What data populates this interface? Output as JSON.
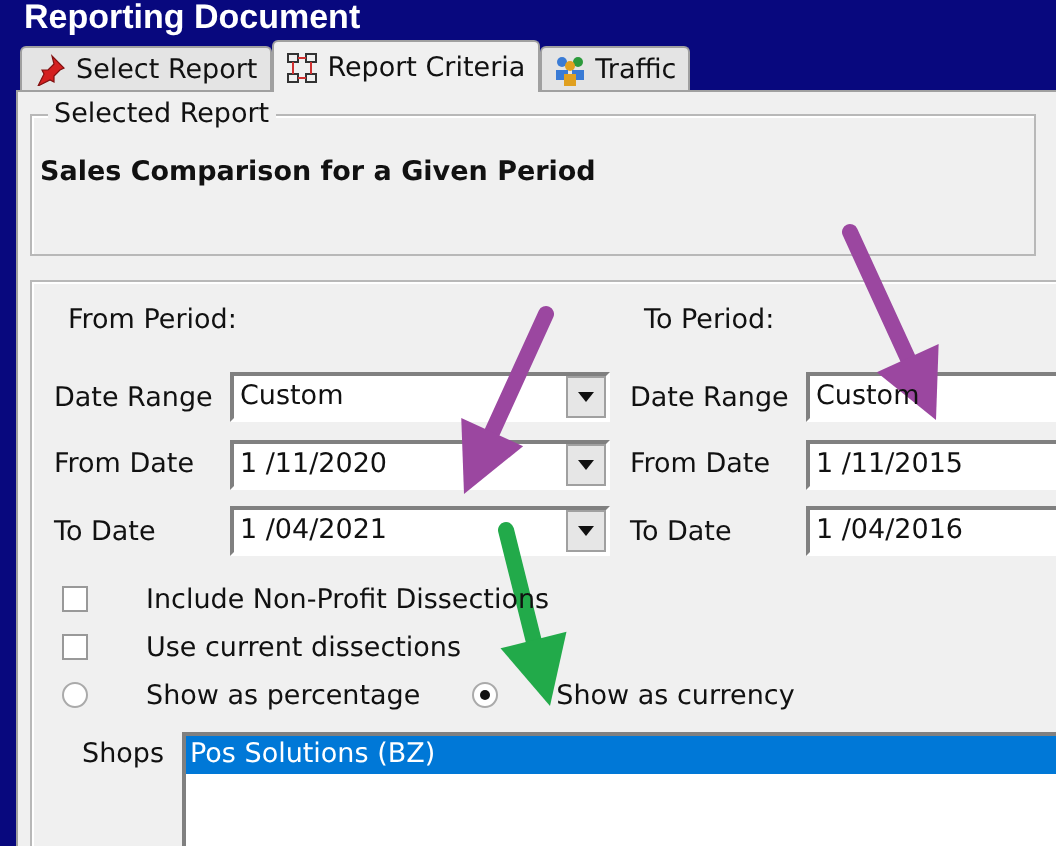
{
  "window": {
    "title": "Reporting Document"
  },
  "tabs": [
    {
      "label": "Select Report",
      "kind": "pushpin",
      "selected": false
    },
    {
      "label": "Report Criteria",
      "kind": "diagram",
      "selected": true
    },
    {
      "label": "Traffic",
      "kind": "people",
      "selected": false
    }
  ],
  "selected_report": {
    "legend": "Selected Report",
    "name": "Sales Comparison for a Given Period"
  },
  "periods": [
    {
      "heading": "From Period:",
      "fields": [
        {
          "label": "Date Range",
          "value": "Custom"
        },
        {
          "label": "From Date",
          "value": "1 /11/2020"
        },
        {
          "label": "To Date",
          "value": "1 /04/2021"
        }
      ]
    },
    {
      "heading": "To Period:",
      "fields": [
        {
          "label": "Date Range",
          "value": "Custom"
        },
        {
          "label": "From Date",
          "value": "1 /11/2015"
        },
        {
          "label": "To Date",
          "value": "1 /04/2016"
        }
      ]
    }
  ],
  "checkboxes": [
    {
      "label": "Include Non-Profit Dissections",
      "checked": false
    },
    {
      "label": "Use current dissections",
      "checked": false
    }
  ],
  "radios": [
    {
      "label": "Show as percentage",
      "selected": false
    },
    {
      "label": "Show as currency",
      "selected": true
    }
  ],
  "shops": {
    "label": "Shops",
    "items": [
      {
        "name": "Pos Solutions (BZ)",
        "selected": true
      }
    ]
  },
  "annotations": [
    {
      "color": "#9b47a0"
    },
    {
      "color": "#9b47a0"
    },
    {
      "color": "#22aa4a"
    }
  ]
}
